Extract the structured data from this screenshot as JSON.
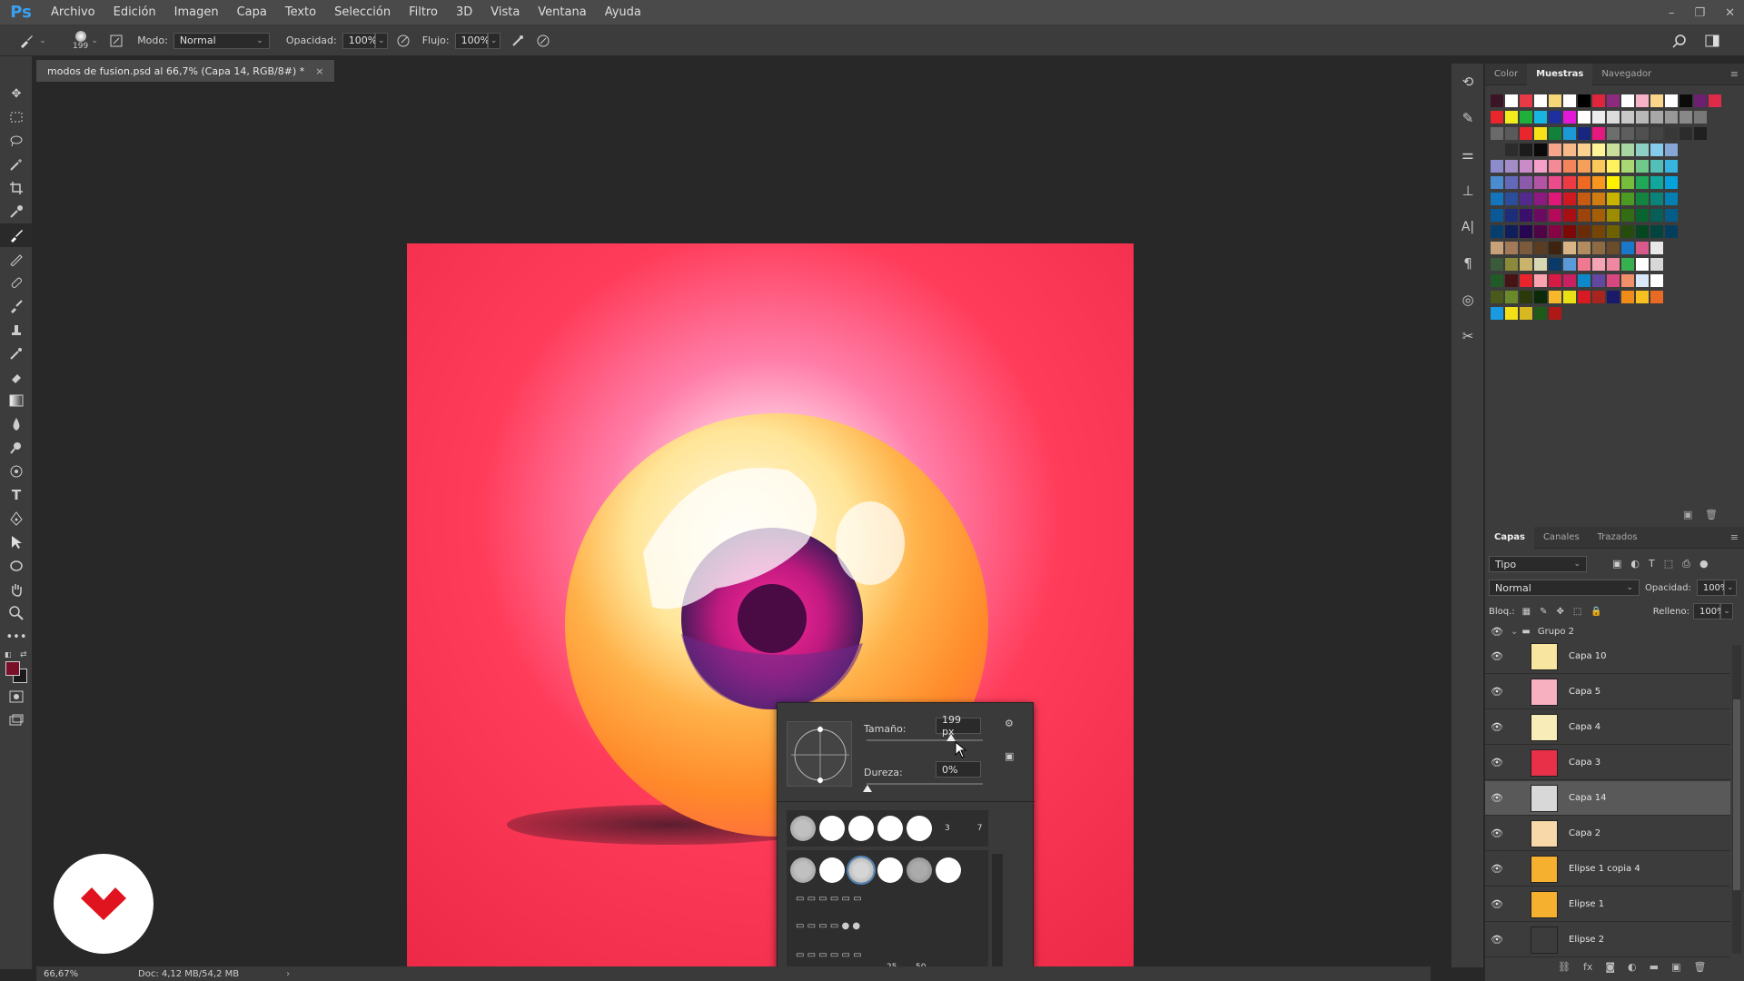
{
  "app": {
    "logo": "Ps"
  },
  "menu": [
    "Archivo",
    "Edición",
    "Imagen",
    "Capa",
    "Texto",
    "Selección",
    "Filtro",
    "3D",
    "Vista",
    "Ventana",
    "Ayuda"
  ],
  "window_controls": [
    "–",
    "❐",
    "✕"
  ],
  "options": {
    "brush_size": "199",
    "mode_label": "Modo:",
    "mode_value": "Normal",
    "opacity_label": "Opacidad:",
    "opacity_value": "100%",
    "flow_label": "Flujo:",
    "flow_value": "100%"
  },
  "document": {
    "tab_title": "modos de fusion.psd al 66,7% (Capa 14, RGB/8#) *",
    "tab_close": "×"
  },
  "status": {
    "zoom": "66,67%",
    "doc": "Doc: 4,12 MB/54,2 MB"
  },
  "swatches_panel": {
    "tabs": [
      "Color",
      "Muestras",
      "Navegador"
    ],
    "active_tab": "Muestras",
    "rows": [
      [
        "#3a1526",
        "#ffffff",
        "#e83a46",
        "#ffffff",
        "#f5d77a",
        "#ffffff",
        "#000000",
        "#e0243b",
        "#8e2a7e",
        "#ffffff",
        "#f6b3c8",
        "#fbd58a",
        "#ffffff",
        "#0b0b0b",
        "#6b2170",
        "#e02a4a"
      ],
      [
        "#e8262c",
        "#f2ec1e",
        "#1fb03c",
        "#17b6e0",
        "#1e2fa0",
        "#e21ad8",
        "#ffffff",
        "#ececec",
        "#dcdcdc",
        "#c8c8c8",
        "#b8b8b8",
        "#a8a8a8",
        "#989898",
        "#888888",
        "#787878"
      ],
      [
        "#6a6a6a",
        "#5a5a5a",
        "#e8262c",
        "#f7e21a",
        "#12823a",
        "#1c9ad8",
        "#192680",
        "#e5187f",
        "#6e6e6e",
        "#5e5e5e",
        "#505050",
        "#444444",
        "#383838",
        "#2c2c2c",
        "#202020"
      ],
      [
        "#3c3c3c",
        "#2c2c2c",
        "#1c1c1c",
        "#0a0a0a",
        "#f5a58c",
        "#f7b98a",
        "#fbd190",
        "#fff39a",
        "#c8df9a",
        "#a7d6a3",
        "#8ecfc4",
        "#85cbea",
        "#86a6d6"
      ],
      [
        "#8c8ccc",
        "#a38cc8",
        "#c98cc8",
        "#f4a0c8",
        "#f48a96",
        "#f4845c",
        "#f4a05a",
        "#fbc85c",
        "#fff25e",
        "#a8d874",
        "#6ec98a",
        "#52c0b8",
        "#38b4e0"
      ],
      [
        "#4a8cd0",
        "#6468b8",
        "#8c5aaa",
        "#b454a4",
        "#ec4c8c",
        "#ee3a44",
        "#ee6a22",
        "#f6961e",
        "#fff200",
        "#74be3c",
        "#1ea858",
        "#10a89c",
        "#06a2dc"
      ],
      [
        "#1474bc",
        "#2c4c9c",
        "#522a8c",
        "#8c1a80",
        "#e0187a",
        "#d01820",
        "#c65a10",
        "#d07c10",
        "#c8b400",
        "#4c9a24",
        "#128440",
        "#0a847a",
        "#0480b4"
      ],
      [
        "#0a5896",
        "#1c2e7a",
        "#3a106c",
        "#6a0a60",
        "#b40a5a",
        "#a80e14",
        "#9c440a",
        "#a45e08",
        "#9c8c00",
        "#346c14",
        "#0a6430",
        "#066058",
        "#045c88"
      ],
      [
        "#063e6e",
        "#101e5a",
        "#260650",
        "#4e0446",
        "#860444",
        "#7c0808",
        "#6a2c06",
        "#764404",
        "#6e6200",
        "#264c0c",
        "#064620",
        "#04443e",
        "#043e5e"
      ],
      [
        "#c9a27a",
        "#a27a5a",
        "#7c5a3c",
        "#5a3c22",
        "#3c2410",
        "#d8b484",
        "#b08c60",
        "#8c6a44",
        "#6a4c2c",
        "#1a78c8",
        "#d85a8a",
        "#e8e8e8"
      ],
      [
        "#3a5a3a",
        "#8a8a3a",
        "#c8b46a",
        "#d8d8b4",
        "#0a3a6a",
        "#5a9ad8",
        "#f07890",
        "#f4a4b4",
        "#ee88a0",
        "#38b050",
        "#ffffff",
        "#d8d8d8"
      ],
      [
        "#205a26",
        "#461414",
        "#e8242c",
        "#fba4b0",
        "#d81a46",
        "#c82060",
        "#0e88c8",
        "#6248a0",
        "#d84880",
        "#f0906a",
        "#d8e8f8",
        "#ffffff"
      ],
      [
        "#4a5a1a",
        "#6a8a2a",
        "#2a3a0a",
        "#0a2a0a",
        "#f6b82a",
        "#e8e014",
        "#d81a22",
        "#a8241e",
        "#1a1a6a",
        "#f08c1a",
        "#f6c020",
        "#e86a24"
      ],
      [
        "#1a9ae0",
        "#f2e018",
        "#d8b820",
        "#205a1a",
        "#b01818"
      ]
    ]
  },
  "layers_panel": {
    "tabs": [
      "Capas",
      "Canales",
      "Trazados"
    ],
    "active_tab": "Capas",
    "filter": "Tipo",
    "blend_mode": "Normal",
    "opacity_label": "Opacidad:",
    "opacity_value": "100%",
    "lock_label": "Bloq.:",
    "fill_label": "Relleno:",
    "fill_value": "100%",
    "group_name": "Grupo 2",
    "layers": [
      {
        "name": "Capa 10",
        "selected": false,
        "thumb": "#f8e6a0"
      },
      {
        "name": "Capa 5",
        "selected": false,
        "thumb": "#f7b0c0"
      },
      {
        "name": "Capa 4",
        "selected": false,
        "thumb": "#f8ecb8"
      },
      {
        "name": "Capa 3",
        "selected": false,
        "thumb": "#e83048"
      },
      {
        "name": "Capa 14",
        "selected": true,
        "thumb": "#d8d8d8"
      },
      {
        "name": "Capa 2",
        "selected": false,
        "thumb": "#f8d8a8"
      },
      {
        "name": "Elipse 1 copia 4",
        "selected": false,
        "thumb": "#f5b030"
      },
      {
        "name": "Elipse 1",
        "selected": false,
        "thumb": "#f5b030"
      },
      {
        "name": "Elipse 2",
        "selected": false,
        "thumb": "#3c3c3c"
      }
    ]
  },
  "brush_popup": {
    "size_label": "Tamaño:",
    "size_value": "199 px",
    "hardness_label": "Dureza:",
    "hardness_value": "0%",
    "preset_numbers": [
      "3",
      "7",
      "25",
      "50"
    ]
  },
  "colors": {
    "foreground": "#7a0f2a",
    "background": "#1a1a1a",
    "accent": "#3aa0f0"
  }
}
